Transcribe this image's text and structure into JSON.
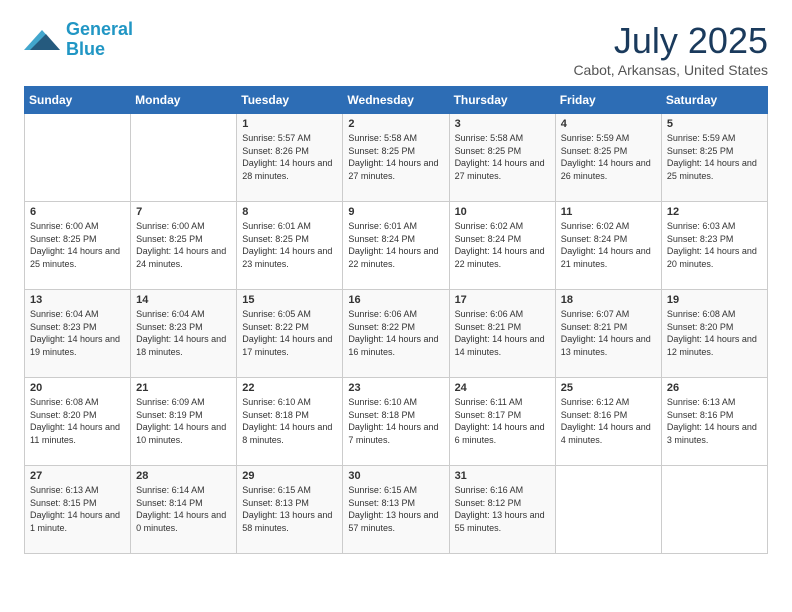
{
  "header": {
    "logo_line1": "General",
    "logo_line2": "Blue",
    "month": "July 2025",
    "location": "Cabot, Arkansas, United States"
  },
  "days_of_week": [
    "Sunday",
    "Monday",
    "Tuesday",
    "Wednesday",
    "Thursday",
    "Friday",
    "Saturday"
  ],
  "weeks": [
    [
      {
        "day": "",
        "text": ""
      },
      {
        "day": "",
        "text": ""
      },
      {
        "day": "1",
        "text": "Sunrise: 5:57 AM\nSunset: 8:26 PM\nDaylight: 14 hours and 28 minutes."
      },
      {
        "day": "2",
        "text": "Sunrise: 5:58 AM\nSunset: 8:25 PM\nDaylight: 14 hours and 27 minutes."
      },
      {
        "day": "3",
        "text": "Sunrise: 5:58 AM\nSunset: 8:25 PM\nDaylight: 14 hours and 27 minutes."
      },
      {
        "day": "4",
        "text": "Sunrise: 5:59 AM\nSunset: 8:25 PM\nDaylight: 14 hours and 26 minutes."
      },
      {
        "day": "5",
        "text": "Sunrise: 5:59 AM\nSunset: 8:25 PM\nDaylight: 14 hours and 25 minutes."
      }
    ],
    [
      {
        "day": "6",
        "text": "Sunrise: 6:00 AM\nSunset: 8:25 PM\nDaylight: 14 hours and 25 minutes."
      },
      {
        "day": "7",
        "text": "Sunrise: 6:00 AM\nSunset: 8:25 PM\nDaylight: 14 hours and 24 minutes."
      },
      {
        "day": "8",
        "text": "Sunrise: 6:01 AM\nSunset: 8:25 PM\nDaylight: 14 hours and 23 minutes."
      },
      {
        "day": "9",
        "text": "Sunrise: 6:01 AM\nSunset: 8:24 PM\nDaylight: 14 hours and 22 minutes."
      },
      {
        "day": "10",
        "text": "Sunrise: 6:02 AM\nSunset: 8:24 PM\nDaylight: 14 hours and 22 minutes."
      },
      {
        "day": "11",
        "text": "Sunrise: 6:02 AM\nSunset: 8:24 PM\nDaylight: 14 hours and 21 minutes."
      },
      {
        "day": "12",
        "text": "Sunrise: 6:03 AM\nSunset: 8:23 PM\nDaylight: 14 hours and 20 minutes."
      }
    ],
    [
      {
        "day": "13",
        "text": "Sunrise: 6:04 AM\nSunset: 8:23 PM\nDaylight: 14 hours and 19 minutes."
      },
      {
        "day": "14",
        "text": "Sunrise: 6:04 AM\nSunset: 8:23 PM\nDaylight: 14 hours and 18 minutes."
      },
      {
        "day": "15",
        "text": "Sunrise: 6:05 AM\nSunset: 8:22 PM\nDaylight: 14 hours and 17 minutes."
      },
      {
        "day": "16",
        "text": "Sunrise: 6:06 AM\nSunset: 8:22 PM\nDaylight: 14 hours and 16 minutes."
      },
      {
        "day": "17",
        "text": "Sunrise: 6:06 AM\nSunset: 8:21 PM\nDaylight: 14 hours and 14 minutes."
      },
      {
        "day": "18",
        "text": "Sunrise: 6:07 AM\nSunset: 8:21 PM\nDaylight: 14 hours and 13 minutes."
      },
      {
        "day": "19",
        "text": "Sunrise: 6:08 AM\nSunset: 8:20 PM\nDaylight: 14 hours and 12 minutes."
      }
    ],
    [
      {
        "day": "20",
        "text": "Sunrise: 6:08 AM\nSunset: 8:20 PM\nDaylight: 14 hours and 11 minutes."
      },
      {
        "day": "21",
        "text": "Sunrise: 6:09 AM\nSunset: 8:19 PM\nDaylight: 14 hours and 10 minutes."
      },
      {
        "day": "22",
        "text": "Sunrise: 6:10 AM\nSunset: 8:18 PM\nDaylight: 14 hours and 8 minutes."
      },
      {
        "day": "23",
        "text": "Sunrise: 6:10 AM\nSunset: 8:18 PM\nDaylight: 14 hours and 7 minutes."
      },
      {
        "day": "24",
        "text": "Sunrise: 6:11 AM\nSunset: 8:17 PM\nDaylight: 14 hours and 6 minutes."
      },
      {
        "day": "25",
        "text": "Sunrise: 6:12 AM\nSunset: 8:16 PM\nDaylight: 14 hours and 4 minutes."
      },
      {
        "day": "26",
        "text": "Sunrise: 6:13 AM\nSunset: 8:16 PM\nDaylight: 14 hours and 3 minutes."
      }
    ],
    [
      {
        "day": "27",
        "text": "Sunrise: 6:13 AM\nSunset: 8:15 PM\nDaylight: 14 hours and 1 minute."
      },
      {
        "day": "28",
        "text": "Sunrise: 6:14 AM\nSunset: 8:14 PM\nDaylight: 14 hours and 0 minutes."
      },
      {
        "day": "29",
        "text": "Sunrise: 6:15 AM\nSunset: 8:13 PM\nDaylight: 13 hours and 58 minutes."
      },
      {
        "day": "30",
        "text": "Sunrise: 6:15 AM\nSunset: 8:13 PM\nDaylight: 13 hours and 57 minutes."
      },
      {
        "day": "31",
        "text": "Sunrise: 6:16 AM\nSunset: 8:12 PM\nDaylight: 13 hours and 55 minutes."
      },
      {
        "day": "",
        "text": ""
      },
      {
        "day": "",
        "text": ""
      }
    ]
  ]
}
